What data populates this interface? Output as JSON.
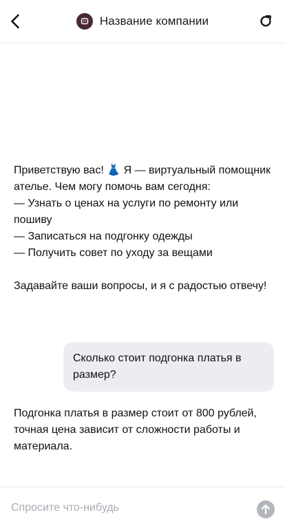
{
  "header": {
    "title": "Название компании",
    "back_icon": "chevron-left-icon",
    "logo_icon": "chat-bot-logo-icon",
    "refresh_icon": "refresh-icon",
    "logo_color": "#4a2b33"
  },
  "messages": {
    "bot_greeting": {
      "paragraph1": [
        "Приветствую вас! 👗 Я — виртуальный помощник ателье. Чем могу помочь вам сегодня:",
        "— Узнать о ценах на услуги по ремонту или пошиву",
        "— Записаться на подгонку одежды",
        "— Получить совет по уходу за вещами"
      ],
      "paragraph2": "Задавайте ваши вопросы, и я с радостью отвечу!"
    },
    "user_message": "Сколько стоит подгонка платья в размер?",
    "bot_reply": "Подгонка платья в размер стоит от 800 рублей, точная цена зависит от сложности работы и материала."
  },
  "composer": {
    "placeholder": "Спросите что-нибудь",
    "value": "",
    "send_icon": "arrow-up-icon"
  },
  "colors": {
    "user_bubble": "#ecedf0",
    "send_button": "#b4b6bd",
    "divider": "#e8e9ec"
  }
}
